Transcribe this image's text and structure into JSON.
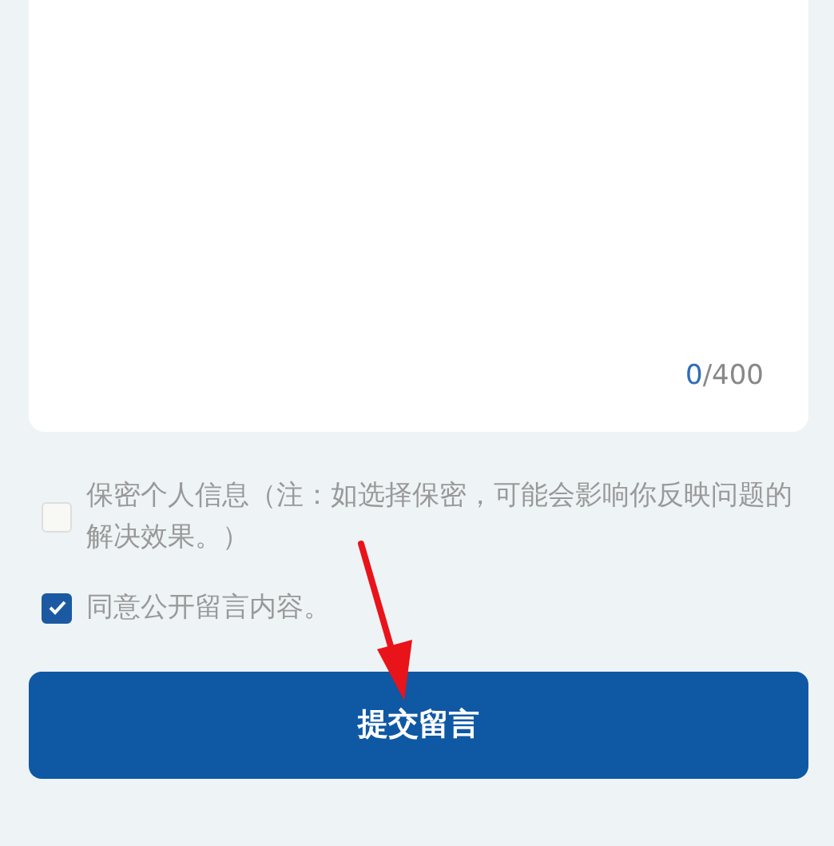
{
  "message_box": {
    "count": "0",
    "max": "/400"
  },
  "options": [
    {
      "label": "保密个人信息（注：如选择保密，可能会影响你反映问题的解决效果。）",
      "checked": false
    },
    {
      "label": "同意公开留言内容。",
      "checked": true
    }
  ],
  "submit_button": "提交留言"
}
